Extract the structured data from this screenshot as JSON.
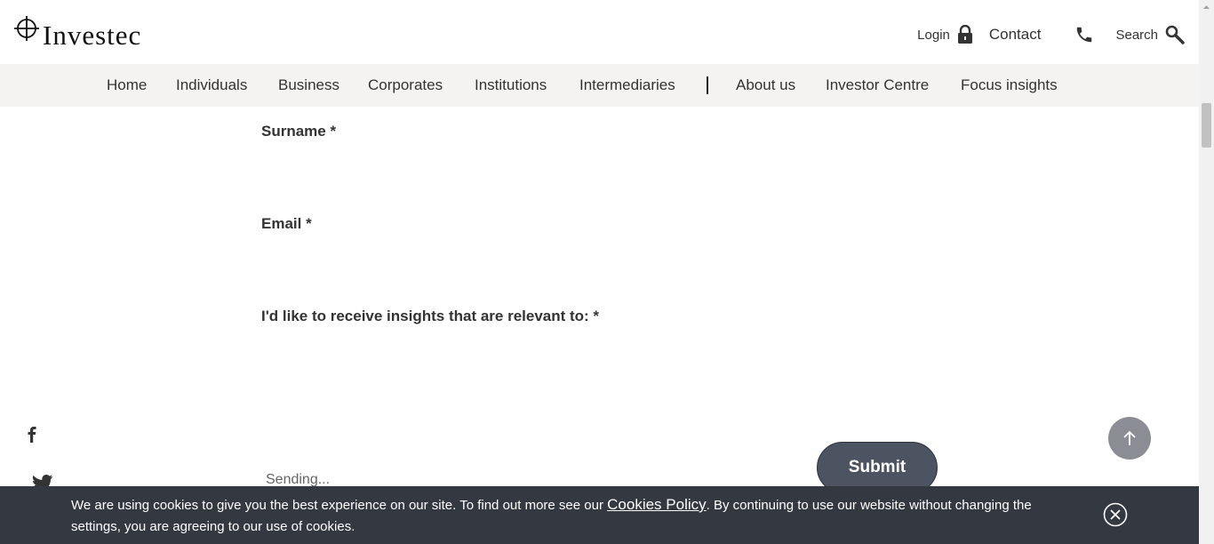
{
  "brand": {
    "name": "Investec"
  },
  "utility": {
    "login": "Login",
    "contact": "Contact",
    "search": "Search"
  },
  "nav": {
    "items": [
      "Home",
      "Individuals",
      "Business",
      "Corporates",
      "Institutions",
      "Intermediaries",
      "About us",
      "Investor Centre",
      "Focus insights"
    ]
  },
  "form": {
    "surname_label": "Surname *",
    "email_label": "Email *",
    "insights_label": "I'd like to receive insights that are relevant to: *",
    "status": "Sending...",
    "submit": "Submit"
  },
  "social": [
    "facebook-icon",
    "twitter-icon"
  ],
  "cookie": {
    "text_before": "We are using cookies to give you the best experience on our site. To find out more see our ",
    "link": "Cookies Policy",
    "text_after": ". By continuing to use our website without changing the settings, you are agreeing to our use of cookies."
  },
  "colors": {
    "nav_bg": "#f4f3f1",
    "submit_bg": "#4d5461",
    "cookie_bg": "#343841",
    "to_top_bg": "#8a8d93"
  }
}
